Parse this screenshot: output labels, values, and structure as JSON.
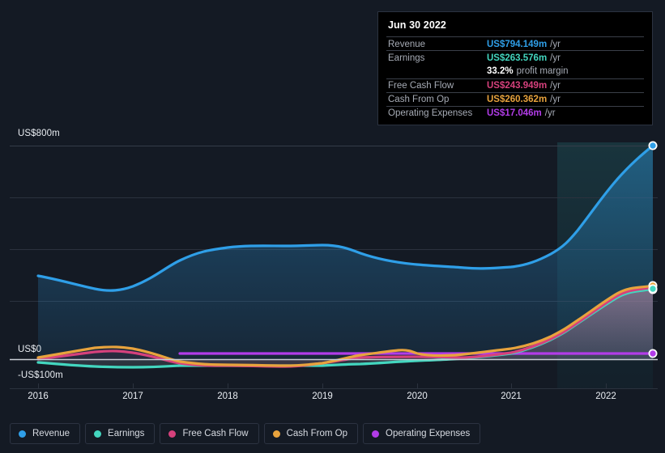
{
  "tooltip": {
    "date": "Jun 30 2022",
    "rows": [
      {
        "key": "Revenue",
        "value": "US$794.149m",
        "unit": "/yr",
        "color": "#2f9fe8"
      },
      {
        "key": "Earnings",
        "value": "US$263.576m",
        "unit": "/yr",
        "color": "#43d6bf"
      },
      {
        "key": "Free Cash Flow",
        "value": "US$243.949m",
        "unit": "/yr",
        "color": "#d6417c"
      },
      {
        "key": "Cash From Op",
        "value": "US$260.362m",
        "unit": "/yr",
        "color": "#e8a33d"
      },
      {
        "key": "Operating Expenses",
        "value": "US$17.046m",
        "unit": "/yr",
        "color": "#b23ce8"
      }
    ],
    "profit_margin_value": "33.2%",
    "profit_margin_label": "profit margin"
  },
  "legend": [
    {
      "label": "Revenue",
      "color": "#2f9fe8"
    },
    {
      "label": "Earnings",
      "color": "#43d6bf"
    },
    {
      "label": "Free Cash Flow",
      "color": "#d6417c"
    },
    {
      "label": "Cash From Op",
      "color": "#e8a33d"
    },
    {
      "label": "Operating Expenses",
      "color": "#b23ce8"
    }
  ],
  "axis": {
    "y_top_label": "US$800m",
    "y_zero_label": "US$0",
    "y_neg_label": "-US$100m",
    "x_labels": [
      "2016",
      "2017",
      "2018",
      "2019",
      "2020",
      "2021",
      "2022"
    ]
  },
  "chart_data": {
    "type": "area",
    "title": "",
    "xlabel": "",
    "ylabel": "",
    "ylim": [
      -100,
      800
    ],
    "grid": true,
    "legend_position": "bottom",
    "x_tick_labels": [
      "2016",
      "2017",
      "2018",
      "2019",
      "2020",
      "2021",
      "2022"
    ],
    "y_tick_labels": [
      "US$800m",
      "US$0",
      "-US$100m"
    ],
    "units": "US$ millions per year",
    "highlight_region_start_x_label": "2021.6",
    "x": [
      2016.0,
      2016.25,
      2016.5,
      2016.75,
      2017.0,
      2017.25,
      2017.5,
      2017.75,
      2018.0,
      2018.25,
      2018.5,
      2018.75,
      2019.0,
      2019.25,
      2019.5,
      2019.75,
      2020.0,
      2020.25,
      2020.5,
      2020.75,
      2021.0,
      2021.25,
      2021.5,
      2021.75,
      2022.0,
      2022.25,
      2022.5
    ],
    "series": [
      {
        "name": "Revenue",
        "color": "#2f9fe8",
        "values": [
          356,
          342,
          328,
          315,
          306,
          320,
          345,
          375,
          404,
          425,
          432,
          434,
          440,
          442,
          436,
          420,
          404,
          392,
          382,
          376,
          368,
          372,
          392,
          455,
          545,
          665,
          794
        ]
      },
      {
        "name": "Earnings",
        "color": "#43d6bf",
        "values": [
          -12,
          -14,
          -17,
          -20,
          -24,
          -26,
          -27,
          -28,
          -28,
          -27,
          -26,
          -25,
          -24,
          -24,
          -24,
          -23,
          -21,
          -19,
          -18,
          -17,
          -15,
          -10,
          6,
          45,
          105,
          180,
          264
        ]
      },
      {
        "name": "Free Cash Flow",
        "color": "#d6417c",
        "values": [
          -4,
          2,
          8,
          14,
          16,
          12,
          4,
          -6,
          -14,
          -18,
          -20,
          -22,
          -24,
          -25,
          -24,
          -20,
          -10,
          -2,
          2,
          4,
          2,
          4,
          18,
          56,
          108,
          175,
          244
        ]
      },
      {
        "name": "Cash From Op",
        "color": "#e8a33d",
        "values": [
          2,
          8,
          14,
          20,
          23,
          20,
          12,
          0,
          -10,
          -15,
          -17,
          -18,
          -19,
          -19,
          -17,
          -12,
          -2,
          8,
          14,
          16,
          12,
          14,
          26,
          62,
          114,
          182,
          260
        ]
      },
      {
        "name": "Operating Expenses",
        "color": "#b23ce8",
        "values": [
          null,
          null,
          null,
          null,
          null,
          null,
          -8,
          -8,
          -8,
          -8,
          -8,
          -8,
          -8,
          -8,
          -8,
          -8,
          -8,
          -8,
          -8,
          -8,
          -8,
          -8,
          -8,
          -8,
          -8,
          5,
          17
        ]
      }
    ]
  }
}
